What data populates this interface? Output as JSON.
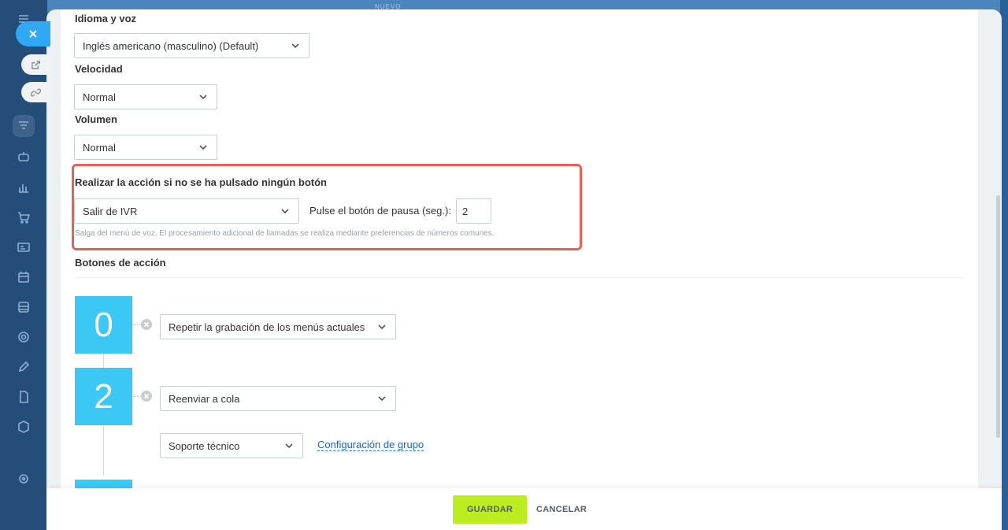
{
  "background": {
    "top_label": "NUEVO"
  },
  "voice": {
    "title": "Idioma y voz",
    "value": "Inglés americano (masculino) (Default)"
  },
  "speed": {
    "title": "Velocidad",
    "value": "Normal"
  },
  "volume": {
    "title": "Volumen",
    "value": "Normal"
  },
  "no_press": {
    "title": "Realizar la acción si no se ha pulsado ningún botón",
    "action_value": "Salir de IVR",
    "pause_label": "Pulse el botón de pausa (seg.):",
    "pause_value": "2",
    "hint": "Salga del menú de voz. El procesamiento adicional de llamadas se realiza mediante preferencias de números comunes."
  },
  "action_buttons": {
    "title": "Botones de acción",
    "items": [
      {
        "digit": "0",
        "action": "Repetir la grabación de los menús actuales"
      },
      {
        "digit": "2",
        "action": "Reenviar a cola",
        "queue": "Soporte técnico",
        "link": "Configuración de grupo"
      }
    ]
  },
  "footer": {
    "save": "GUARDAR",
    "cancel": "CANCELAR"
  },
  "colors": {
    "accent": "#3bc8f5",
    "save": "#bbed21",
    "highlight": "#e0645a",
    "link": "#2067b0"
  }
}
